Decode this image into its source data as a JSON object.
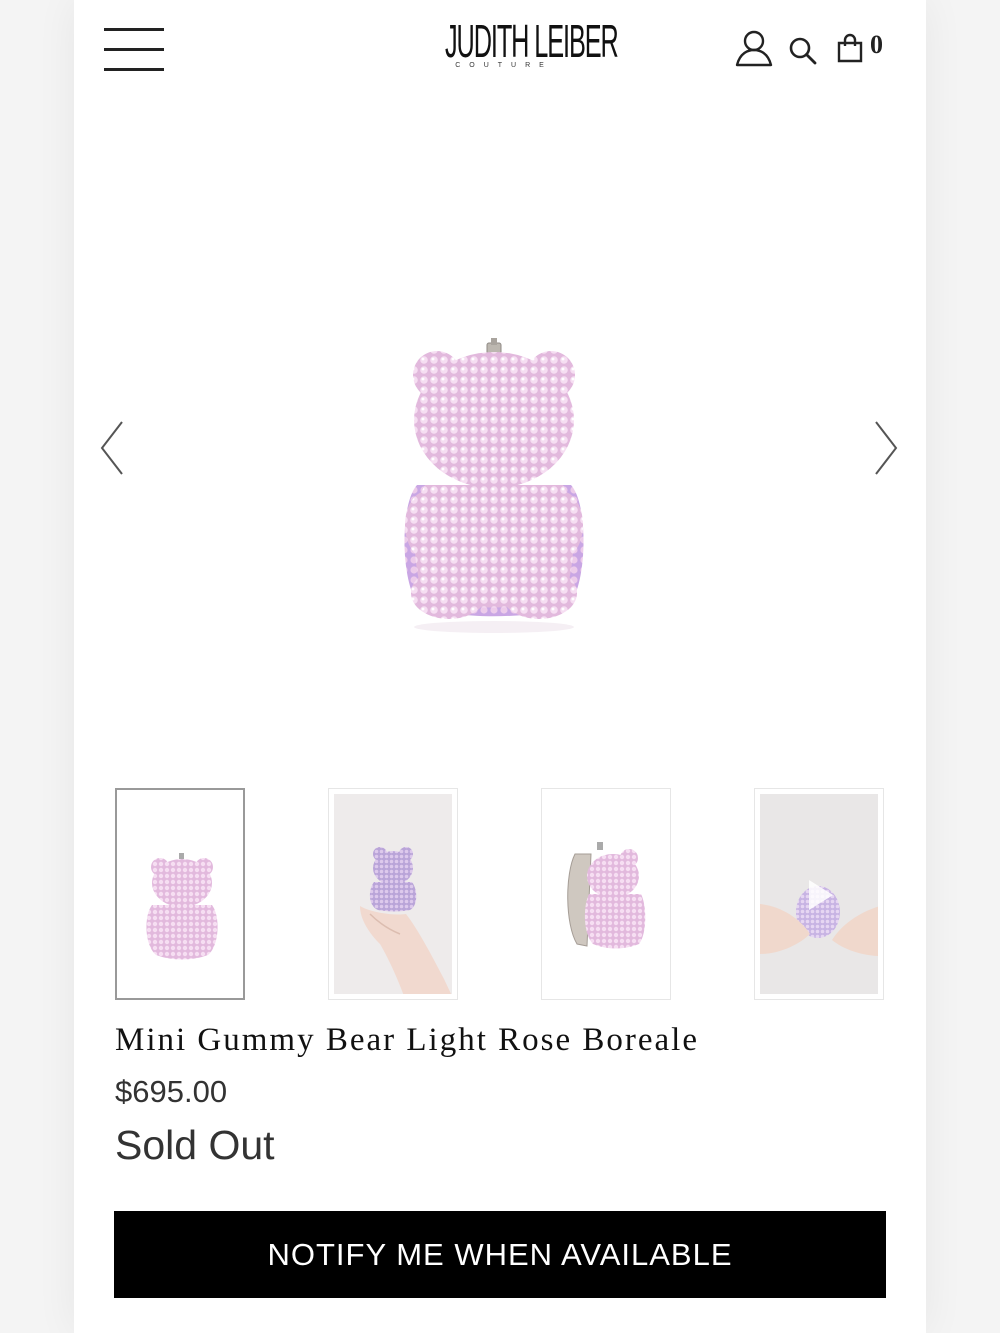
{
  "header": {
    "logo_main": "JUDITH LEIBER",
    "logo_sub": "COUTURE",
    "cart_count": "0",
    "icons": [
      "menu-icon",
      "account-icon",
      "search-icon",
      "shopping-bag-icon"
    ]
  },
  "gallery": {
    "main_image": "pink crystal gummy bear clutch",
    "thumbnails": [
      {
        "label": "bear front",
        "active": true
      },
      {
        "label": "bear held in hand"
      },
      {
        "label": "bear open side view"
      },
      {
        "label": "video thumbnail hands holding bear",
        "video": true
      }
    ],
    "icons": [
      "chevron-left-icon",
      "chevron-right-icon",
      "play-icon"
    ]
  },
  "product": {
    "title": "Mini Gummy Bear Light Rose Boreale",
    "price": "$695.00",
    "stock_status": "Sold Out",
    "notify_label": "NOTIFY ME WHEN AVAILABLE"
  },
  "colors": {
    "accent": "#000000",
    "crystal_pink": "#e9c3e3",
    "crystal_lavender": "#c9a6e4"
  }
}
